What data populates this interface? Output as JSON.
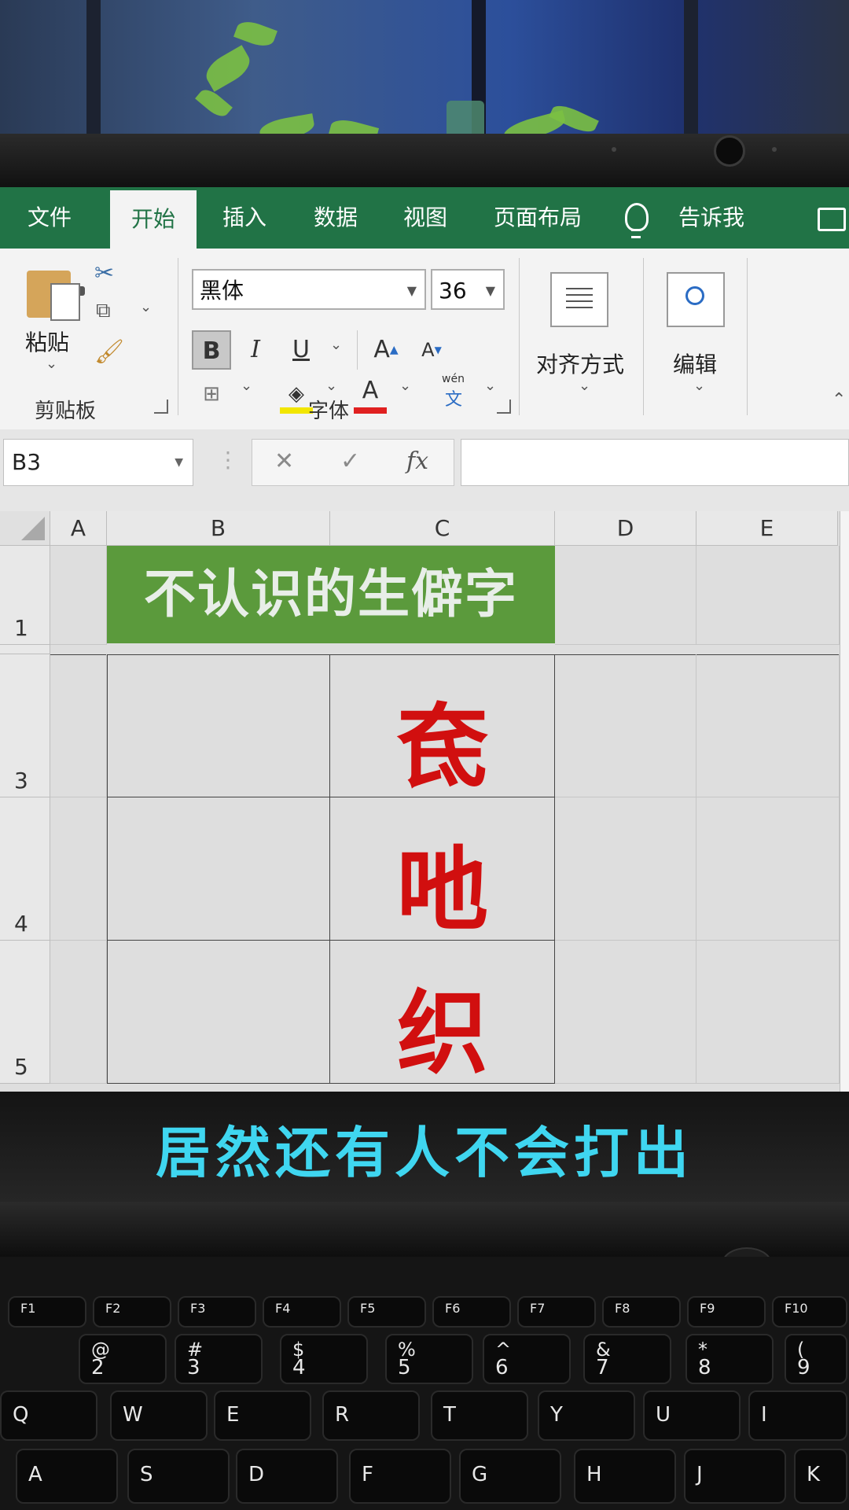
{
  "ribbon_tabs": [
    {
      "label": "文件"
    },
    {
      "label": "开始"
    },
    {
      "label": "插入"
    },
    {
      "label": "数据"
    },
    {
      "label": "视图"
    },
    {
      "label": "页面布局"
    },
    {
      "label": "告诉我"
    }
  ],
  "clipboard": {
    "paste_label": "粘贴",
    "group_label": "剪贴板"
  },
  "font": {
    "name": "黑体",
    "size": "36",
    "group_label": "字体",
    "phonetic_top": "wén",
    "phonetic_bottom": "文"
  },
  "alignment": {
    "label": "对齐方式"
  },
  "editing": {
    "label": "编辑"
  },
  "formula_bar": {
    "name_box": "B3",
    "fx": "fx",
    "cancel": "✕",
    "confirm": "✓",
    "value": ""
  },
  "columns": [
    "A",
    "B",
    "C",
    "D",
    "E"
  ],
  "rows": [
    "1",
    "3",
    "4",
    "5"
  ],
  "cells": {
    "title": "不认识的生僻字",
    "c3": "奃",
    "c4": "吔",
    "c5": "织"
  },
  "subtitle": "居然还有人不会打出",
  "keyboard": {
    "function_keys": [
      "F1",
      "F2",
      "F3",
      "F4",
      "F5",
      "F6",
      "F7",
      "F8",
      "F9",
      "F10"
    ],
    "number_row": [
      {
        "top": "@",
        "bottom": "2"
      },
      {
        "top": "#",
        "bottom": "3"
      },
      {
        "top": "$",
        "bottom": "4"
      },
      {
        "top": "%",
        "bottom": "5"
      },
      {
        "top": "^",
        "bottom": "6"
      },
      {
        "top": "&",
        "bottom": "7"
      },
      {
        "top": "*",
        "bottom": "8"
      },
      {
        "top": "(",
        "bottom": "9"
      }
    ],
    "qwerty_row": [
      "Q",
      "W",
      "E",
      "R",
      "T",
      "Y",
      "U",
      "I"
    ],
    "asdf_row": [
      "A",
      "S",
      "D",
      "F",
      "G",
      "H",
      "J",
      "K"
    ]
  },
  "colors": {
    "excel_green": "#217346",
    "title_fill": "#5b9a3c",
    "char_red": "#d10f0f",
    "subtitle_cyan": "#3fd6f0"
  }
}
